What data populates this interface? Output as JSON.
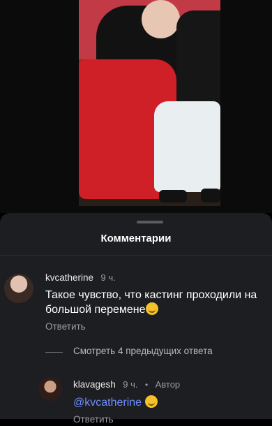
{
  "sheet": {
    "title": "Комментарии"
  },
  "comments": [
    {
      "user": "kvcatherine",
      "time": "9 ч.",
      "text": "Такое чувство, что кастинг проходили на большой перемене",
      "emoji": "grinning-sweat-emoji",
      "action": "Ответить"
    }
  ],
  "view_more": "Смотреть 4 предыдущих ответа",
  "reply": {
    "user": "klavagesh",
    "time": "9 ч.",
    "sep": "•",
    "role": "Автор",
    "mention": "@kvcatherine",
    "emoji": "grinning-emoji",
    "action": "Ответить"
  }
}
